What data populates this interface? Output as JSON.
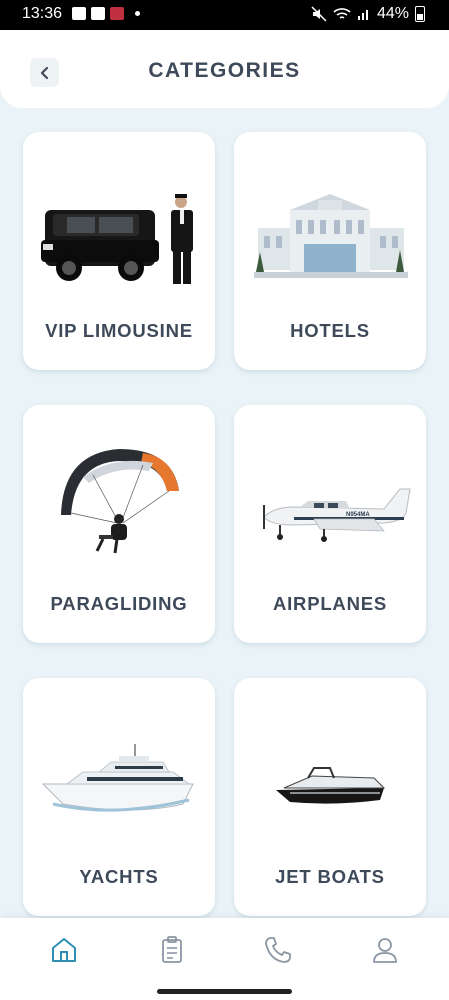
{
  "status_bar": {
    "time": "13:36",
    "battery": "44%"
  },
  "header": {
    "title": "CATEGORIES"
  },
  "categories": [
    {
      "label": "VIP LIMOUSINE"
    },
    {
      "label": "HOTELS"
    },
    {
      "label": "PARAGLIDING"
    },
    {
      "label": "AIRPLANES"
    },
    {
      "label": "YACHTS"
    },
    {
      "label": "JET BOATS"
    }
  ],
  "airplane_tail_number": "N954MA",
  "bottom_nav": {
    "active": "home-tab",
    "accent_color": "#2f8fb0",
    "icon_color": "#8a96a3"
  }
}
